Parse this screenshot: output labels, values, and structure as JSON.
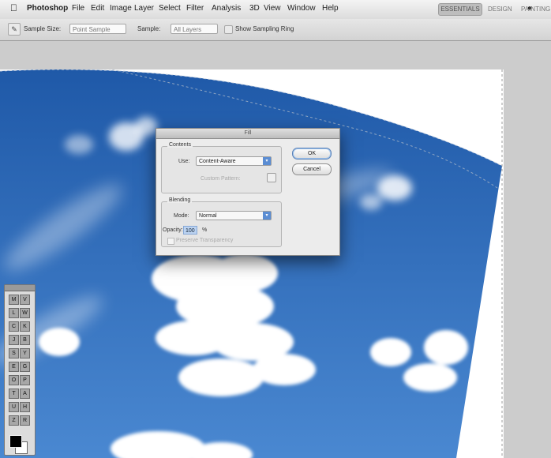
{
  "menubar": {
    "app": "Photoshop",
    "items": [
      "File",
      "Edit",
      "Image",
      "Layer",
      "Select",
      "Filter",
      "Analysis",
      "3D",
      "View",
      "Window",
      "Help"
    ],
    "workspace": [
      "ESSENTIALS",
      "DESIGN",
      "PAINTING"
    ]
  },
  "options_bar": {
    "sample_size_label": "Sample Size:",
    "sample_size_value": "Point Sample",
    "sample_label": "Sample:",
    "sample_value": "All Layers",
    "show_ring_label": "Show Sampling Ring"
  },
  "dialog": {
    "title": "Fill",
    "contents": {
      "heading": "Contents",
      "use_label": "Use:",
      "use_value": "Content-Aware",
      "custom_pattern_label": "Custom Pattern:"
    },
    "blending": {
      "heading": "Blending",
      "mode_label": "Mode:",
      "mode_value": "Normal",
      "opacity_label": "Opacity:",
      "opacity_value": "100",
      "opacity_unit": "%",
      "preserve_label": "Preserve Transparency"
    },
    "ok_label": "OK",
    "cancel_label": "Cancel"
  },
  "toolbox": {
    "tools": [
      "M",
      "V",
      "L",
      "W",
      "C",
      "K",
      "J",
      "B",
      "S",
      "Y",
      "E",
      "G",
      "O",
      "P",
      "T",
      "A",
      "U",
      "H",
      "Z",
      "R"
    ]
  },
  "colors": {
    "sky_top": "#1f59a8",
    "sky_bottom": "#4a88d1",
    "accent": "#5b8dd3"
  }
}
